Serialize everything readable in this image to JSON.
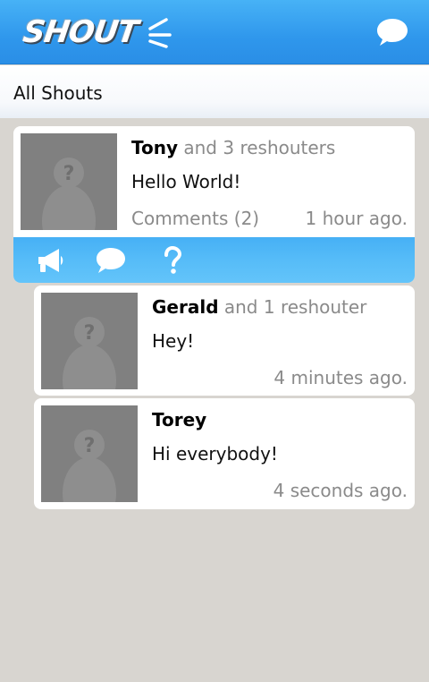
{
  "app": {
    "logo_text": "SHOUT",
    "brand_color": "#2f97ec",
    "icons": {
      "compose": "speech-bubble-icon"
    }
  },
  "subheader": {
    "title": "All Shouts"
  },
  "shouts": [
    {
      "name": "Tony",
      "reshouters": "and 3 reshouters",
      "message": "Hello World!",
      "comments": "Comments (2)",
      "time": "1 hour ago.",
      "actions": [
        "megaphone-icon",
        "speech-bubble-icon",
        "question-icon"
      ]
    },
    {
      "name": "Gerald",
      "reshouters": "and 1 reshouter",
      "message": "Hey!",
      "time": "4 minutes ago."
    },
    {
      "name": "Torey",
      "reshouters": "",
      "message": "Hi everybody!",
      "time": "4 seconds ago."
    }
  ]
}
